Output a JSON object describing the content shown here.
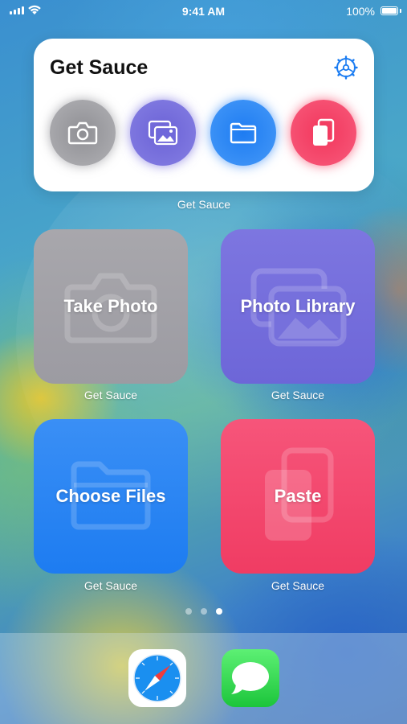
{
  "status_bar": {
    "time": "9:41 AM",
    "battery_percent": "100%",
    "icons": [
      "cellular-signal-icon",
      "wifi-icon",
      "battery-icon"
    ]
  },
  "widget": {
    "title": "Get Sauce",
    "label": "Get Sauce",
    "settings_icon": "gear-icon",
    "actions": [
      {
        "icon": "camera-icon",
        "color": "#9a9a9f"
      },
      {
        "icon": "photos-icon",
        "color": "#736bdc"
      },
      {
        "icon": "folder-icon",
        "color": "#2a85f4"
      },
      {
        "icon": "paste-icon",
        "color": "#f44468"
      }
    ]
  },
  "shortcuts": [
    {
      "title": "Take Photo",
      "label": "Get Sauce",
      "icon": "camera-icon",
      "color": "#a3a2a8"
    },
    {
      "title": "Photo Library",
      "label": "Get Sauce",
      "icon": "photos-icon",
      "color": "#7670dc"
    },
    {
      "title": "Choose Files",
      "label": "Get Sauce",
      "icon": "folder-icon",
      "color": "#2b86f3"
    },
    {
      "title": "Paste",
      "label": "Get Sauce",
      "icon": "paste-icon",
      "color": "#f3486e"
    }
  ],
  "page_indicator": {
    "total": 3,
    "current": 3
  },
  "dock": {
    "apps": [
      {
        "name": "Safari",
        "icon": "safari-compass-icon"
      },
      {
        "name": "Messages",
        "icon": "messages-bubble-icon"
      }
    ]
  }
}
